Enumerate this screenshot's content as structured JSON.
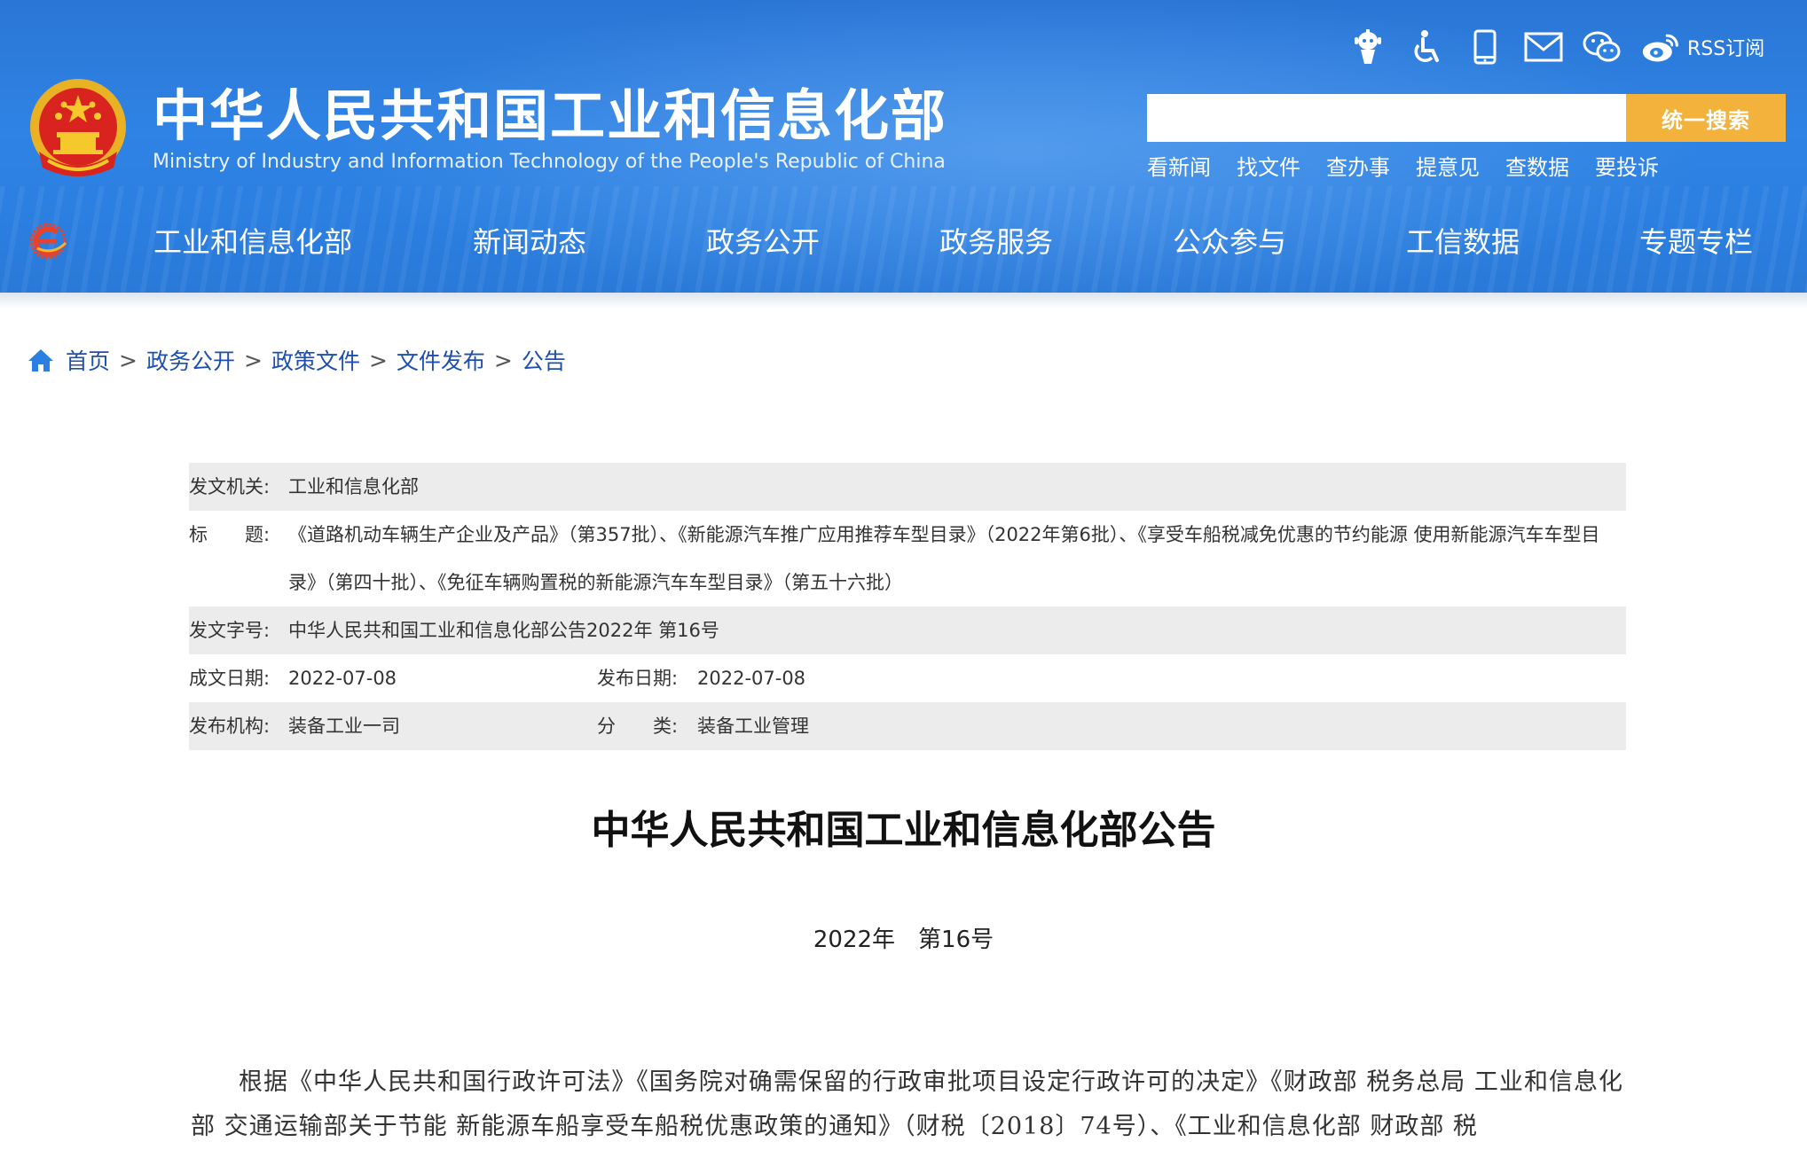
{
  "header": {
    "title": "中华人民共和国工业和信息化部",
    "subtitle": "Ministry of Industry and Information Technology of the People's Republic of China",
    "utility_icons": [
      "robot-icon",
      "accessibility-icon",
      "mobile-icon",
      "mail-icon",
      "wechat-icon",
      "weibo-icon"
    ],
    "rss_label": "RSS订阅",
    "search": {
      "placeholder": "",
      "button_label": "统一搜索"
    },
    "quick_links": [
      "看新闻",
      "找文件",
      "查办事",
      "提意见",
      "查数据",
      "要投诉"
    ],
    "nav": [
      "工业和信息化部",
      "新闻动态",
      "政务公开",
      "政务服务",
      "公众参与",
      "工信数据",
      "专题专栏"
    ],
    "colors": {
      "primary": "#2b7fe0",
      "search_button": "#f2b23c"
    }
  },
  "breadcrumb": [
    "首页",
    "政务公开",
    "政策文件",
    "文件发布",
    "公告"
  ],
  "meta": {
    "issuer_label": "发文机关:",
    "issuer": "工业和信息化部",
    "title_label": "标　　题:",
    "title": "《道路机动车辆生产企业及产品》（第357批）、《新能源汽车推广应用推荐车型目录》（2022年第6批）、《享受车船税减免优惠的节约能源 使用新能源汽车车型目录》（第四十批）、《免征车辆购置税的新能源汽车车型目录》（第五十六批）",
    "doc_no_label": "发文字号:",
    "doc_no": "中华人民共和国工业和信息化部公告2022年 第16号",
    "created_label": "成文日期:",
    "created": "2022-07-08",
    "published_label": "发布日期:",
    "published": "2022-07-08",
    "org_label": "发布机构:",
    "org": "装备工业一司",
    "category_label": "分　　类:",
    "category": "装备工业管理"
  },
  "document": {
    "title": "中华人民共和国工业和信息化部公告",
    "number": "2022年　第16号",
    "body": "根据《中华人民共和国行政许可法》《国务院对确需保留的行政审批项目设定行政许可的决定》《财政部 税务总局 工业和信息化部 交通运输部关于节能 新能源车船享受车船税优惠政策的通知》（财税〔2018〕74号）、《工业和信息化部 财政部 税"
  }
}
